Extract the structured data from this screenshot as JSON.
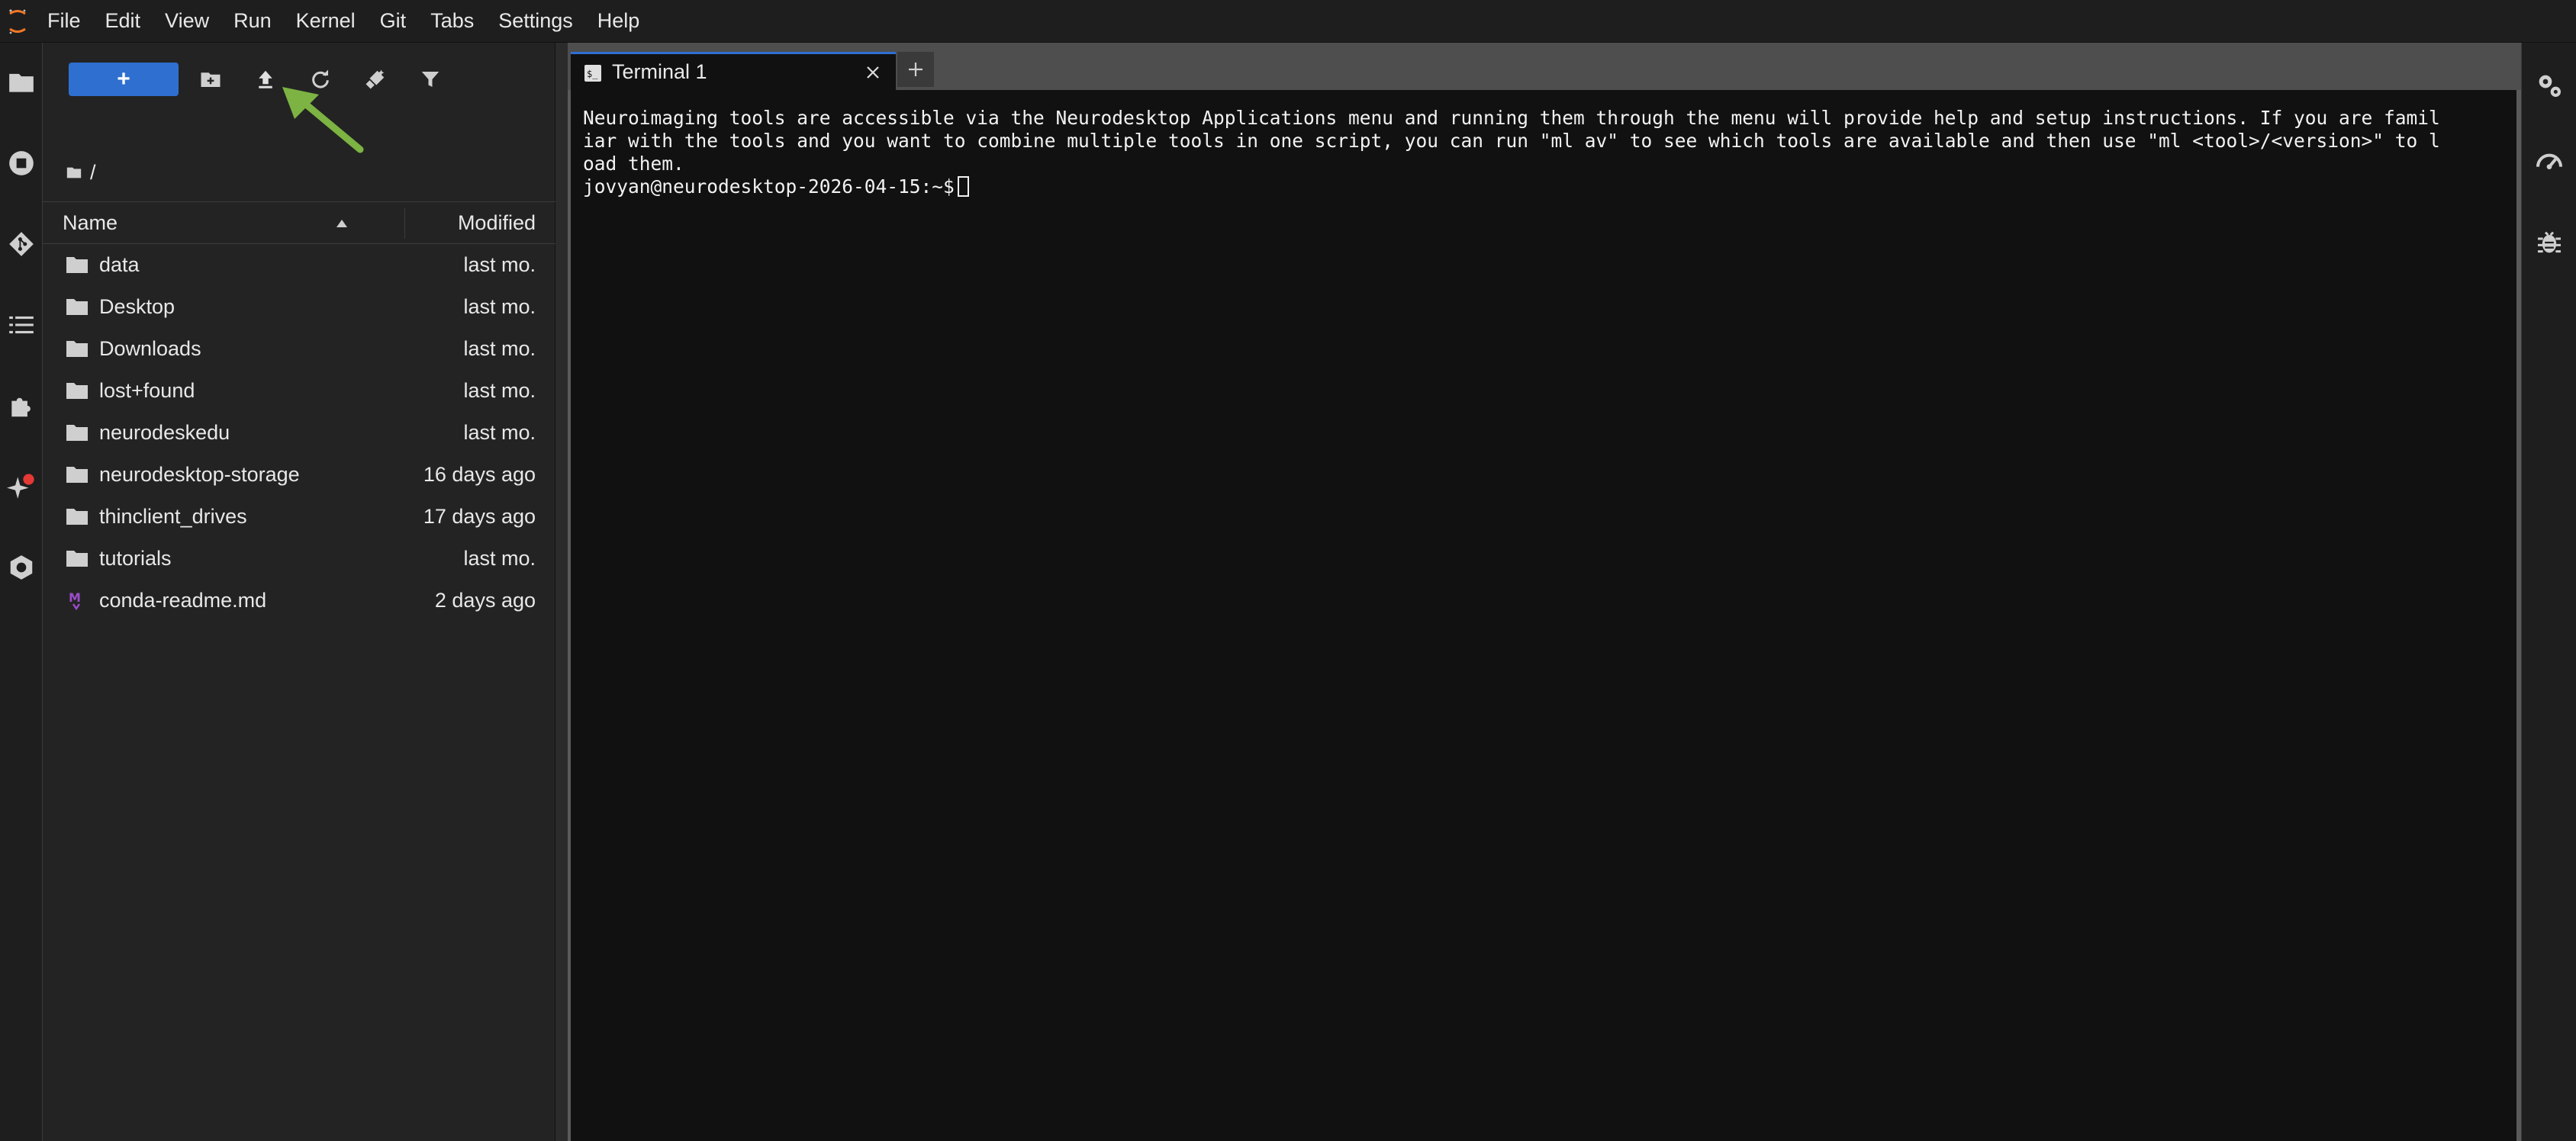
{
  "menubar": {
    "items": [
      "File",
      "Edit",
      "View",
      "Run",
      "Kernel",
      "Git",
      "Tabs",
      "Settings",
      "Help"
    ]
  },
  "left_activity_bar": {
    "icons": [
      "folder-icon",
      "stop-circle-icon",
      "git-icon",
      "table-of-contents-icon",
      "extension-puzzle-icon",
      "ai-sparkle-icon",
      "hexagon-icon"
    ],
    "notification_color": "#e53935"
  },
  "file_browser": {
    "new_button_label": "+",
    "toolbar_icons": [
      "new-folder-icon",
      "upload-icon",
      "refresh-icon",
      "clear-filter-icon",
      "filter-icon"
    ],
    "breadcrumb": "/",
    "columns": {
      "name": "Name",
      "modified": "Modified"
    },
    "files": [
      {
        "name": "data",
        "modified": "last mo.",
        "type": "folder"
      },
      {
        "name": "Desktop",
        "modified": "last mo.",
        "type": "folder"
      },
      {
        "name": "Downloads",
        "modified": "last mo.",
        "type": "folder"
      },
      {
        "name": "lost+found",
        "modified": "last mo.",
        "type": "folder"
      },
      {
        "name": "neurodeskedu",
        "modified": "last mo.",
        "type": "folder"
      },
      {
        "name": "neurodesktop-storage",
        "modified": "16 days ago",
        "type": "folder"
      },
      {
        "name": "thinclient_drives",
        "modified": "17 days ago",
        "type": "folder"
      },
      {
        "name": "tutorials",
        "modified": "last mo.",
        "type": "folder"
      },
      {
        "name": "conda-readme.md",
        "modified": "2 days ago",
        "type": "markdown"
      }
    ]
  },
  "tabs": {
    "terminal_tab_label": "Terminal 1",
    "new_tab_label": "+"
  },
  "terminal": {
    "lines": [
      "Neuroimaging tools are accessible via the Neurodesktop Applications menu and running them through the menu will provide help and setup instructions. If you are famil",
      "iar with the tools and you want to combine multiple tools in one script, you can run \"ml av\" to see which tools are available and then use \"ml <tool>/<version>\" to l",
      "oad them."
    ],
    "prompt": "jovyan@neurodesktop-2026-04-15:~$"
  },
  "right_activity_bar": {
    "icons": [
      "property-inspector-gear-icon",
      "debugger-gauge-icon",
      "bug-icon"
    ]
  },
  "annotation": {
    "color": "#7cb342",
    "points_to": "upload-icon"
  },
  "colors": {
    "accent": "#2f6fd0",
    "background": "#232323",
    "terminal_bg": "#111111",
    "markdown_icon": "#9c4dcc",
    "logo_orange": "#f37726"
  }
}
